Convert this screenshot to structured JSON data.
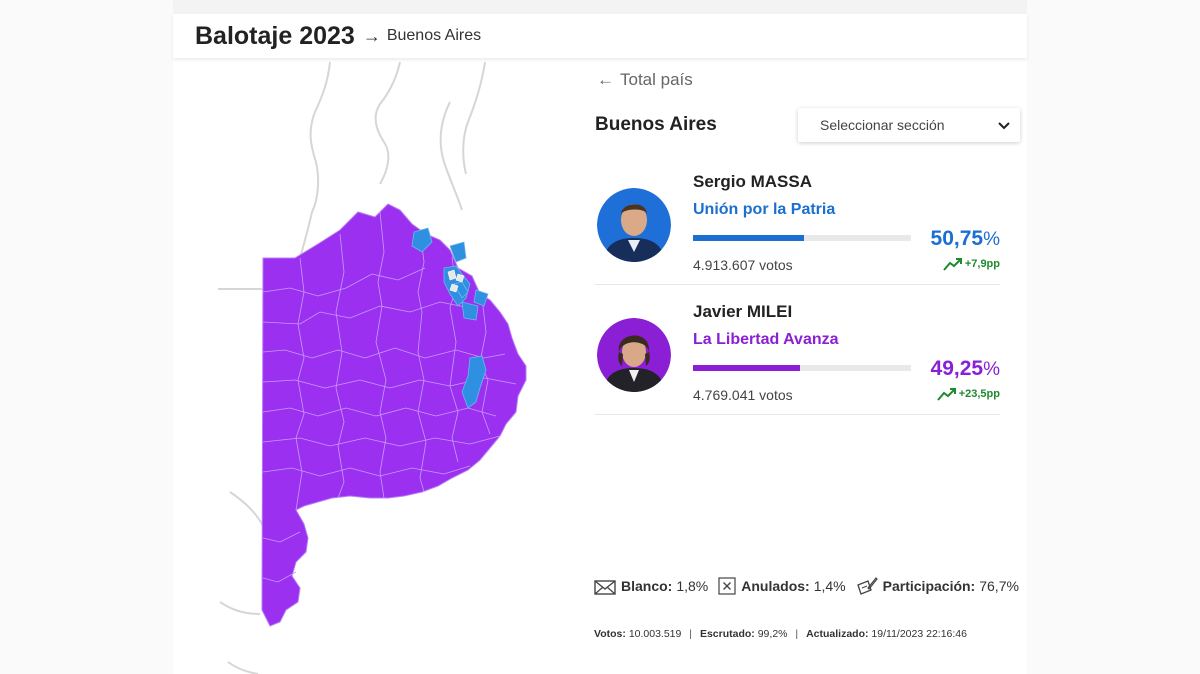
{
  "header": {
    "title": "Balotaje 2023",
    "arrow": "→",
    "breadcrumb": "Buenos Aires"
  },
  "nav": {
    "back_label": "Total país"
  },
  "region": {
    "name": "Buenos Aires",
    "select_placeholder": "Seleccionar sección"
  },
  "colors": {
    "massa": "#1a6fd0",
    "milei": "#8a1fd6",
    "map_purple": "#9b30f0",
    "map_blue": "#2f8fe0",
    "trend_green": "#1e8a2e"
  },
  "candidates": [
    {
      "name": "Sergio MASSA",
      "party": "Unión por la Patria",
      "pct": "50,75",
      "pct_sign": "%",
      "share": 0.5075,
      "votes": "4.913.607 votos",
      "trend": "+7,9pp",
      "color": "#1a6fd0"
    },
    {
      "name": "Javier MILEI",
      "party": "La Libertad Avanza",
      "pct": "49,25",
      "pct_sign": "%",
      "share": 0.4925,
      "votes": "4.769.041 votos",
      "trend": "+23,5pp",
      "color": "#8a1fd6"
    }
  ],
  "stats": {
    "blanco_label": "Blanco:",
    "blanco_value": "1,8%",
    "anulados_label": "Anulados:",
    "anulados_value": "1,4%",
    "participacion_label": "Participación:",
    "participacion_value": "76,7%"
  },
  "footer": {
    "votos_label": "Votos:",
    "votos_value": "10.003.519",
    "escrutado_label": "Escrutado:",
    "escrutado_value": "99,2%",
    "actualizado_label": "Actualizado:",
    "actualizado_value": "19/11/2023 22:16:46",
    "separator": "|"
  }
}
